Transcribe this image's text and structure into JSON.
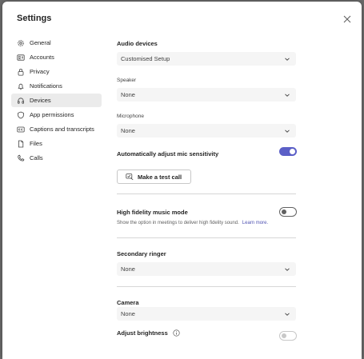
{
  "dialog": {
    "title": "Settings"
  },
  "nav": {
    "items": [
      {
        "label": "General",
        "icon": "gear-icon"
      },
      {
        "label": "Accounts",
        "icon": "accounts-icon"
      },
      {
        "label": "Privacy",
        "icon": "lock-icon"
      },
      {
        "label": "Notifications",
        "icon": "bell-icon"
      },
      {
        "label": "Devices",
        "icon": "headset-icon",
        "active": true
      },
      {
        "label": "App permissions",
        "icon": "shield-icon"
      },
      {
        "label": "Captions and transcripts",
        "icon": "captions-icon"
      },
      {
        "label": "Files",
        "icon": "file-icon"
      },
      {
        "label": "Calls",
        "icon": "phone-icon"
      }
    ]
  },
  "audio": {
    "title": "Audio devices",
    "setup_value": "Customised Setup",
    "speaker_label": "Speaker",
    "speaker_value": "None",
    "microphone_label": "Microphone",
    "microphone_value": "None",
    "auto_adjust_label": "Automatically adjust mic sensitivity",
    "auto_adjust_on": true,
    "test_call_label": "Make a test call"
  },
  "music": {
    "title": "High fidelity music mode",
    "description": "Show the option in meetings to deliver high fidelity sound.",
    "learn_more": "Learn more.",
    "enabled": false
  },
  "ringer": {
    "title": "Secondary ringer",
    "value": "None"
  },
  "camera": {
    "title": "Camera",
    "value": "None",
    "brightness_label": "Adjust brightness",
    "brightness_enabled": false
  },
  "colors": {
    "accent": "#5b5fc7",
    "link": "#4f52b2"
  }
}
